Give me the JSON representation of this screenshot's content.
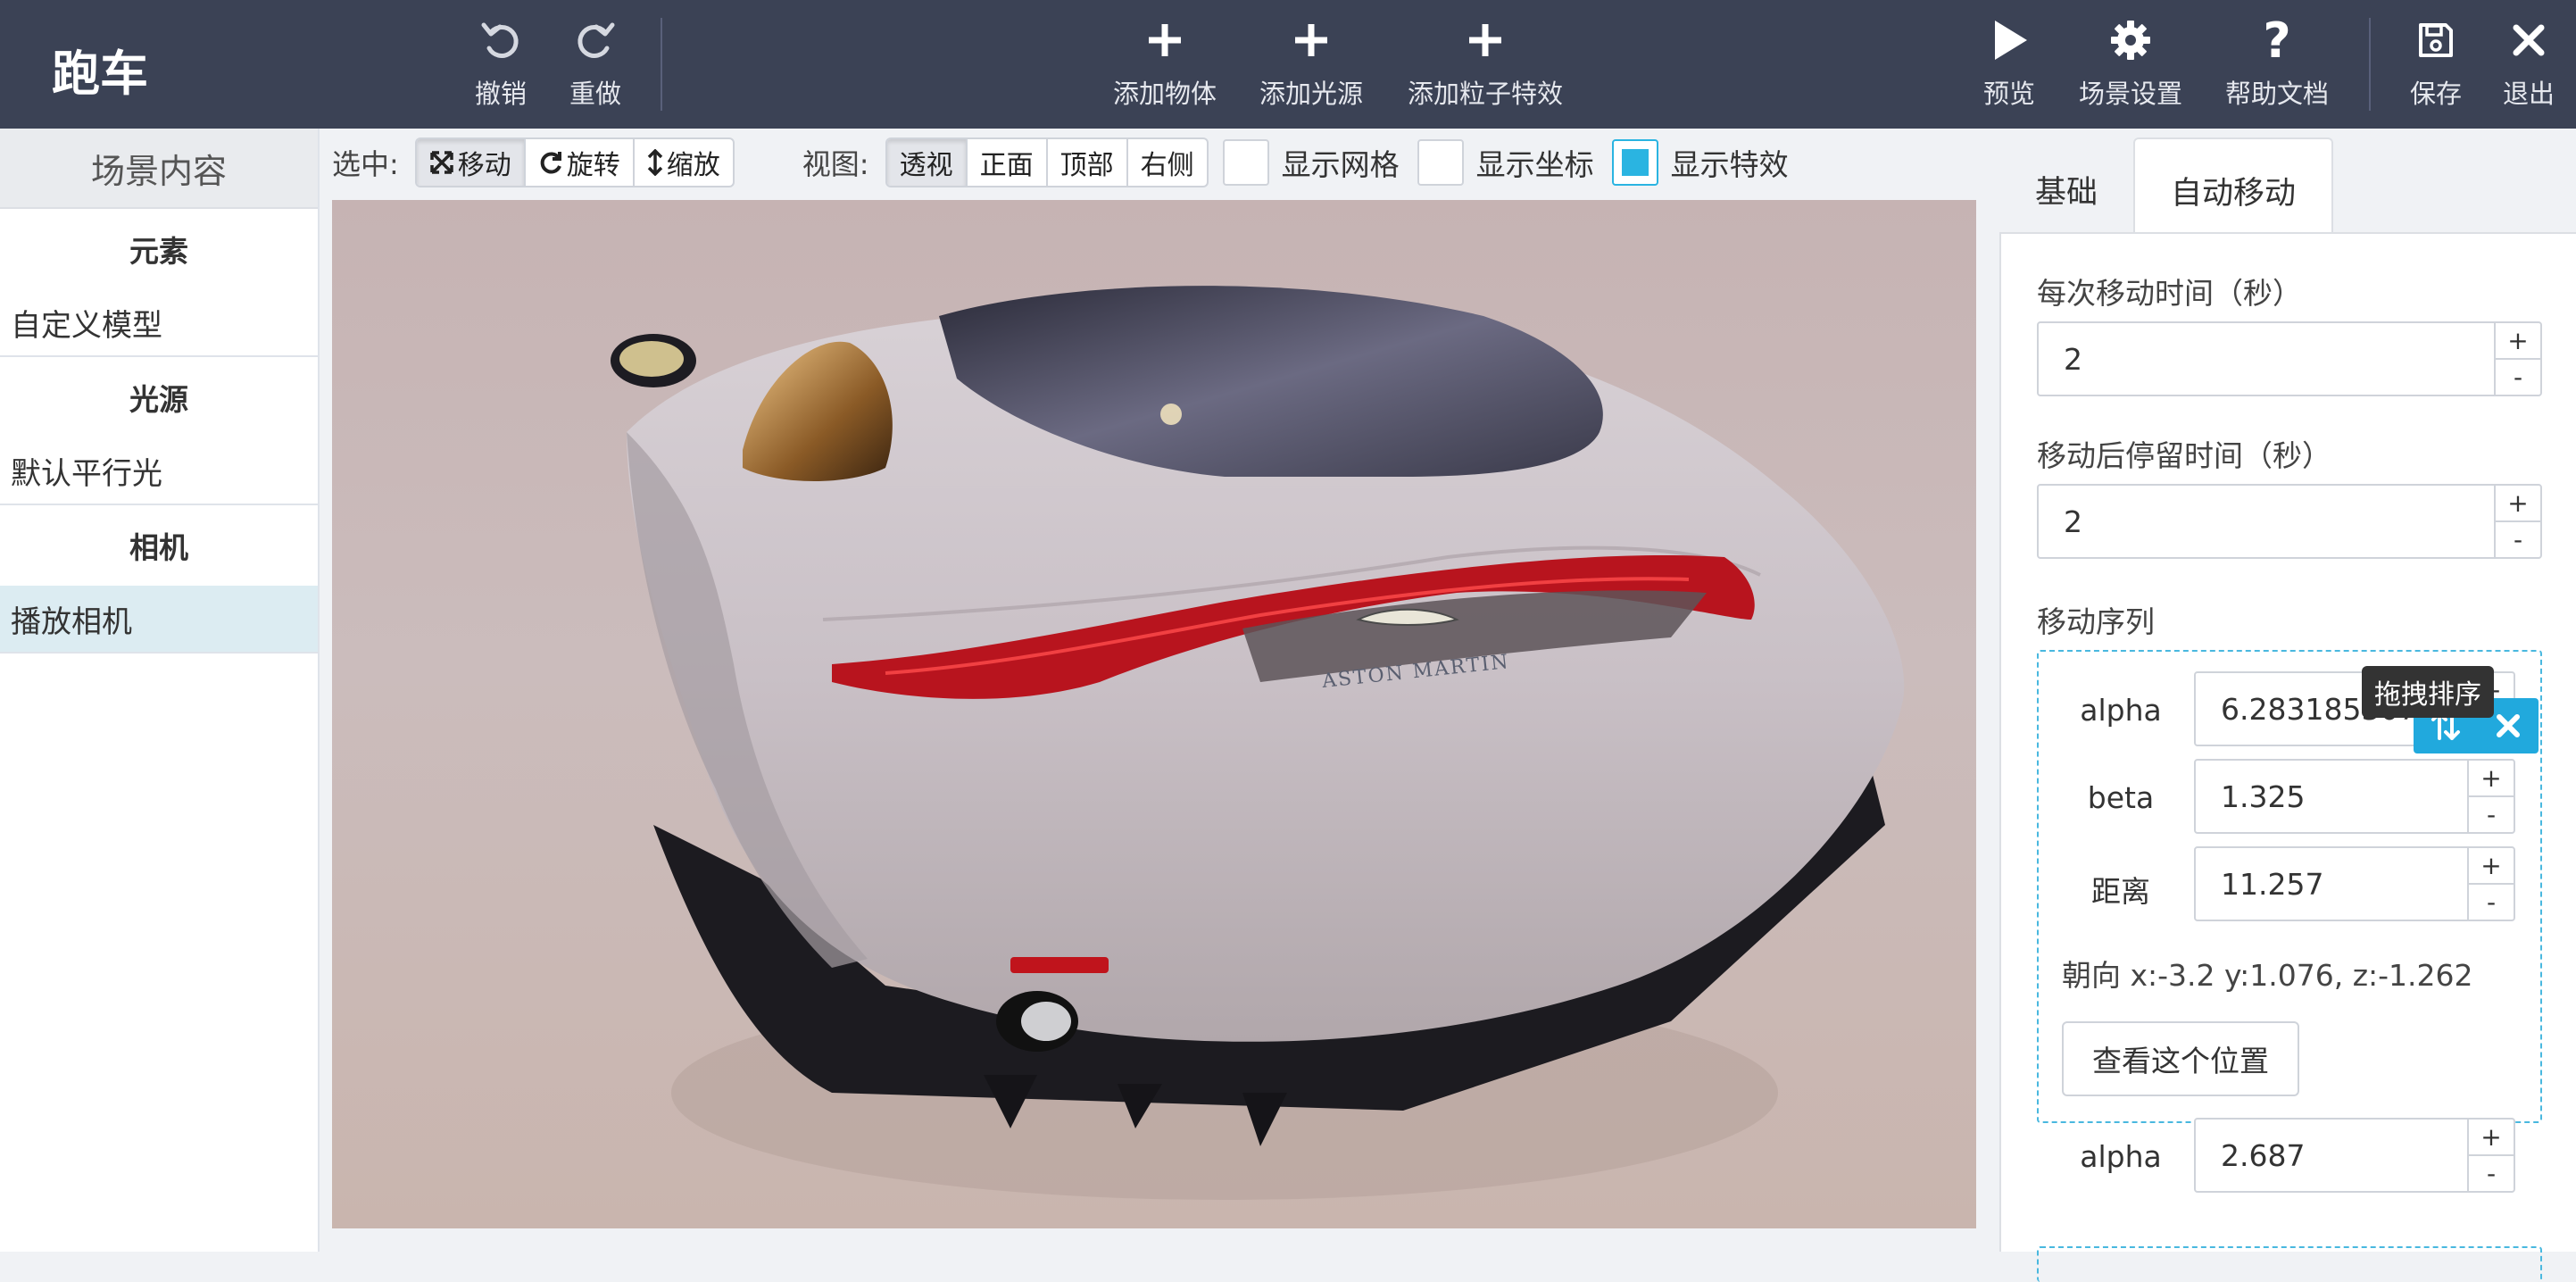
{
  "app": {
    "title": "跑车"
  },
  "toolbar": {
    "undo": "撤销",
    "redo": "重做",
    "add_object": "添加物体",
    "add_light": "添加光源",
    "add_particle": "添加粒子特效",
    "preview": "预览",
    "scene_settings": "场景设置",
    "help": "帮助文档",
    "save": "保存",
    "exit": "退出"
  },
  "sidebar": {
    "title": "场景内容",
    "groups": [
      {
        "label": "元素",
        "items": [
          {
            "label": "自定义模型"
          }
        ]
      },
      {
        "label": "光源",
        "items": [
          {
            "label": "默认平行光"
          }
        ]
      },
      {
        "label": "相机",
        "items": [
          {
            "label": "播放相机",
            "selected": true
          }
        ]
      }
    ]
  },
  "viewtools": {
    "select_label": "选中:",
    "select_modes": [
      {
        "label": "移动",
        "active": true
      },
      {
        "label": "旋转"
      },
      {
        "label": "缩放"
      }
    ],
    "view_label": "视图:",
    "views": [
      {
        "label": "透视",
        "active": true
      },
      {
        "label": "正面"
      },
      {
        "label": "顶部"
      },
      {
        "label": "右侧"
      }
    ],
    "toggles": [
      {
        "label": "显示网格",
        "checked": false
      },
      {
        "label": "显示坐标",
        "checked": false
      },
      {
        "label": "显示特效",
        "checked": true
      }
    ]
  },
  "viewport": {
    "car_badge": "ASTON MARTIN"
  },
  "panel": {
    "tabs": [
      {
        "label": "基础"
      },
      {
        "label": "自动移动",
        "active": true
      }
    ],
    "move_time_label": "每次移动时间（秒）",
    "move_time_value": "2",
    "stay_time_label": "移动后停留时间（秒）",
    "stay_time_value": "2",
    "sequence_label": "移动序列",
    "sequence": [
      {
        "alpha_label": "alpha",
        "alpha": "6.283185307179586",
        "beta_label": "beta",
        "beta": "1.325",
        "distance_label": "距离",
        "distance": "11.257",
        "orientation": "朝向 x:-3.2 y:1.076, z:-1.262",
        "view_button": "查看这个位置"
      },
      {
        "alpha_label": "alpha",
        "alpha": "2.687"
      }
    ],
    "stepper_plus": "+",
    "stepper_minus": "-",
    "tooltip": "拖拽排序"
  },
  "colors": {
    "topbar_bg": "#3b4255",
    "accent": "#21a9dd",
    "selected_item_bg": "#dcecf2"
  }
}
